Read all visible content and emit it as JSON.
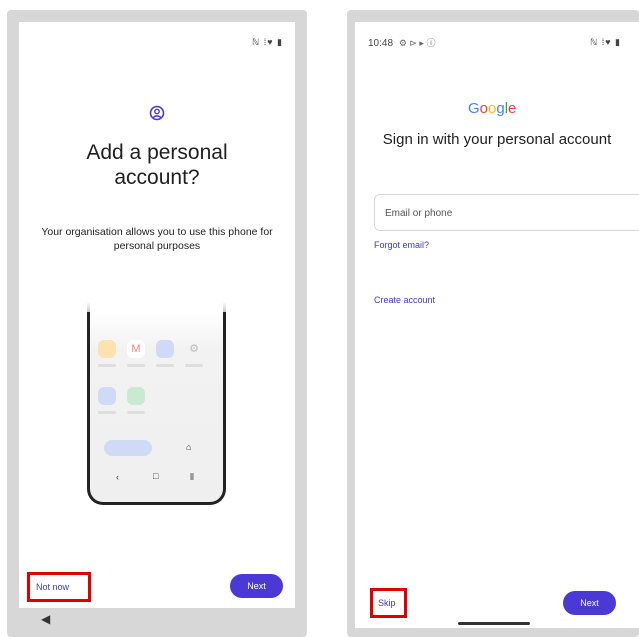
{
  "left_screen": {
    "status_icons": "ℕ ⁞♥ ▮",
    "title": "Add a personal account?",
    "subtitle": "Your organisation allows you to use this phone for personal purposes",
    "not_now_label": "Not now",
    "next_label": "Next"
  },
  "right_screen": {
    "status_time": "10:48",
    "status_notif_icons": "⚙ ⊳ ▸ ⓘ",
    "status_icons": "ℕ ⁞♥ ▮",
    "google_logo_letters": [
      "G",
      "o",
      "o",
      "g",
      "l",
      "e"
    ],
    "google_logo_colors": [
      "#4285F4",
      "#EA4335",
      "#FBBC05",
      "#4285F4",
      "#34A853",
      "#EA4335"
    ],
    "title": "Sign in with your personal account",
    "email_placeholder": "Email or phone",
    "forgot_email_label": "Forgot email?",
    "create_account_label": "Create account",
    "skip_label": "Skip",
    "next_label": "Next"
  },
  "colors": {
    "accent": "#4b39d6",
    "highlight": "#e00000",
    "link": "#3a3ad0"
  }
}
